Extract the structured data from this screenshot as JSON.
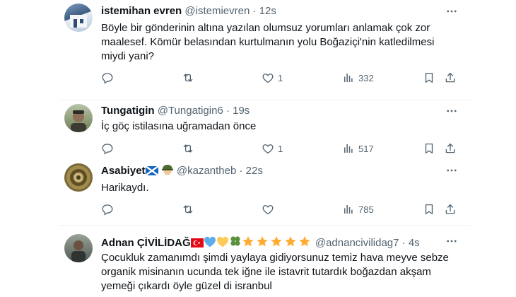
{
  "tweets": [
    {
      "name": "istemihan evren",
      "handle": "@istemievren",
      "dot": "·",
      "time": "12s",
      "text": "Böyle bir gönderinin altına yazılan olumsuz yorumları anlamak çok zor\nmaalesef. Kömür belasından kurtulmanın yolu Boğaziçi'nin katledilmesi\nmiydi yani?",
      "replies": "",
      "retweets": "",
      "likes": "1",
      "views": "332"
    },
    {
      "name": "Tungatigin",
      "handle": "@Tungatigin6",
      "dot": "·",
      "time": "19s",
      "text": "İç göç istilasına uğramadan önce",
      "replies": "",
      "retweets": "",
      "likes": "1",
      "views": "517"
    },
    {
      "name": "Asabiyet",
      "handle": "@kazantheb",
      "dot": "·",
      "time": "22s",
      "text": "Harikaydı.",
      "replies": "",
      "retweets": "",
      "likes": "",
      "views": "785"
    },
    {
      "name": "Adnan ÇİVİLİDAĞ",
      "handle": "@adnancivilidag7",
      "dot": "·",
      "time": "4s",
      "text": "Çocukluk zamanımdı şimdi yaylaya gidiyorsunuz temiz hava meyve sebze\norganik misinanın ucunda tek iğne ile istavrit tutardık boğazdan akşam\nyemeği çıkardı öyle güzel di isranbul"
    }
  ],
  "icons": {
    "more": "more-icon",
    "reply": "reply-icon",
    "retweet": "retweet-icon",
    "like": "like-icon",
    "views": "views-icon",
    "bookmark": "bookmark-icon",
    "share": "share-icon"
  },
  "colors": {
    "text": "#0f1419",
    "muted": "#536471",
    "separator": "#eff3f4"
  }
}
